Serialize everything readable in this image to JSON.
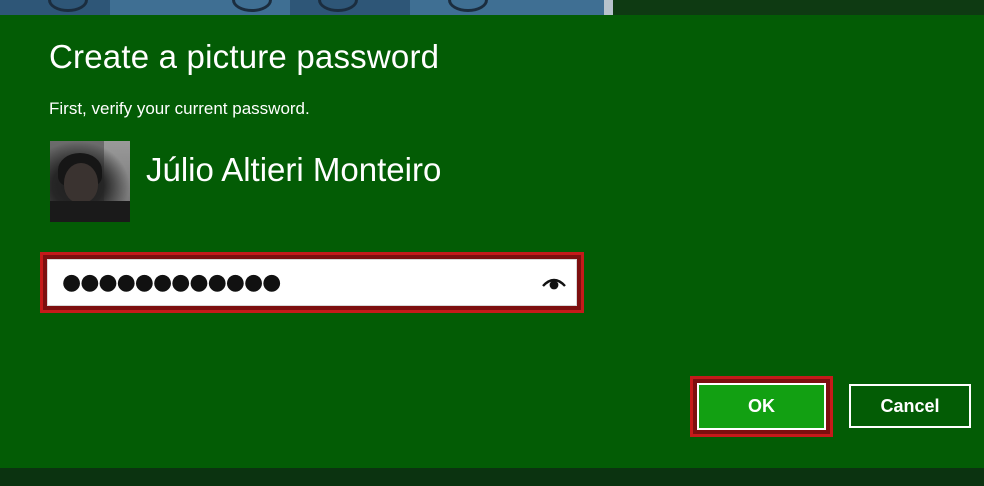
{
  "dialog": {
    "title": "Create a picture password",
    "subtitle": "First, verify your current password.",
    "username": "Júlio Altieri Monteiro",
    "password_mask": "●●●●●●●●●●●●",
    "reveal_icon": "eye-icon",
    "ok_label": "OK",
    "cancel_label": "Cancel"
  },
  "colors": {
    "dialog_background": "#035c05",
    "accent_button": "#12a012",
    "highlight_border": "#c51a1a",
    "text": "#ffffff"
  }
}
